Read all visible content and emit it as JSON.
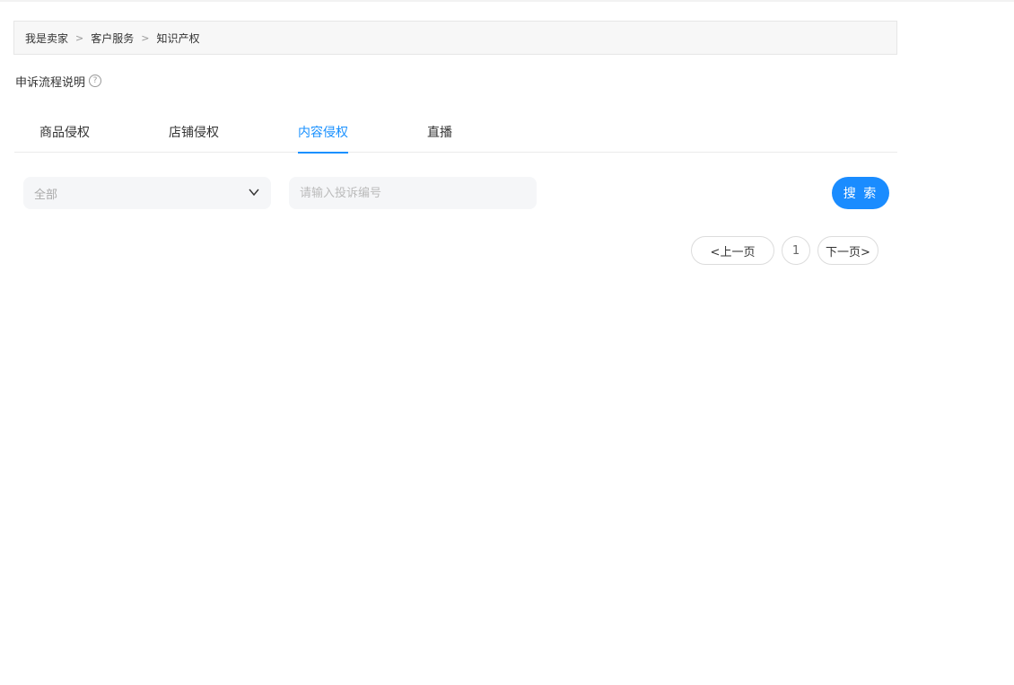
{
  "breadcrumb": {
    "items": [
      "我是卖家",
      "客户服务",
      "知识产权"
    ],
    "separator": ">"
  },
  "help": {
    "label": "申诉流程说明",
    "icon": "question-circle-icon",
    "icon_glyph": "?"
  },
  "tabs": [
    {
      "label": "商品侵权",
      "active": false
    },
    {
      "label": "店铺侵权",
      "active": false
    },
    {
      "label": "内容侵权",
      "active": true
    },
    {
      "label": "直播",
      "active": false
    }
  ],
  "filters": {
    "type_select": {
      "value": "全部"
    },
    "complaint_input": {
      "value": "",
      "placeholder": "请输入投诉编号"
    },
    "search_label": "搜 索"
  },
  "pagination": {
    "prev_label": "<上一页",
    "current_page": "1",
    "next_label": "下一页>"
  },
  "colors": {
    "accent": "#1890ff",
    "button": "#1a8cff"
  }
}
